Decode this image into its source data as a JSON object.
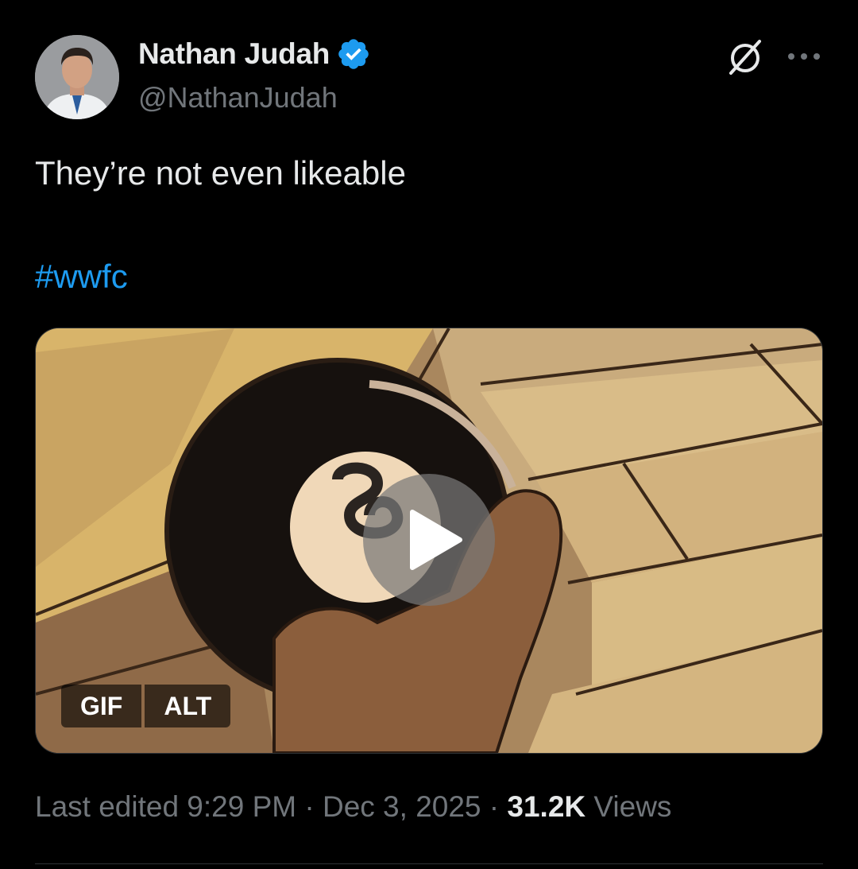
{
  "author": {
    "display_name": "Nathan Judah",
    "handle": "@NathanJudah",
    "verified": true,
    "verified_color": "#1d9bf0"
  },
  "tweet": {
    "text": "They’re not even likeable",
    "hashtag": "#wwfc"
  },
  "media": {
    "badge_gif": "GIF",
    "badge_alt": "ALT",
    "play_icon": "play-icon"
  },
  "meta": {
    "edited": "Last edited 9:29 PM · Dec 3, 2025 · ",
    "views_count": "31.2K",
    "views_label": " Views"
  },
  "colors": {
    "background": "#000000",
    "primary_text": "#e7e9ea",
    "secondary_text": "#71767b",
    "link": "#1d9bf0"
  }
}
